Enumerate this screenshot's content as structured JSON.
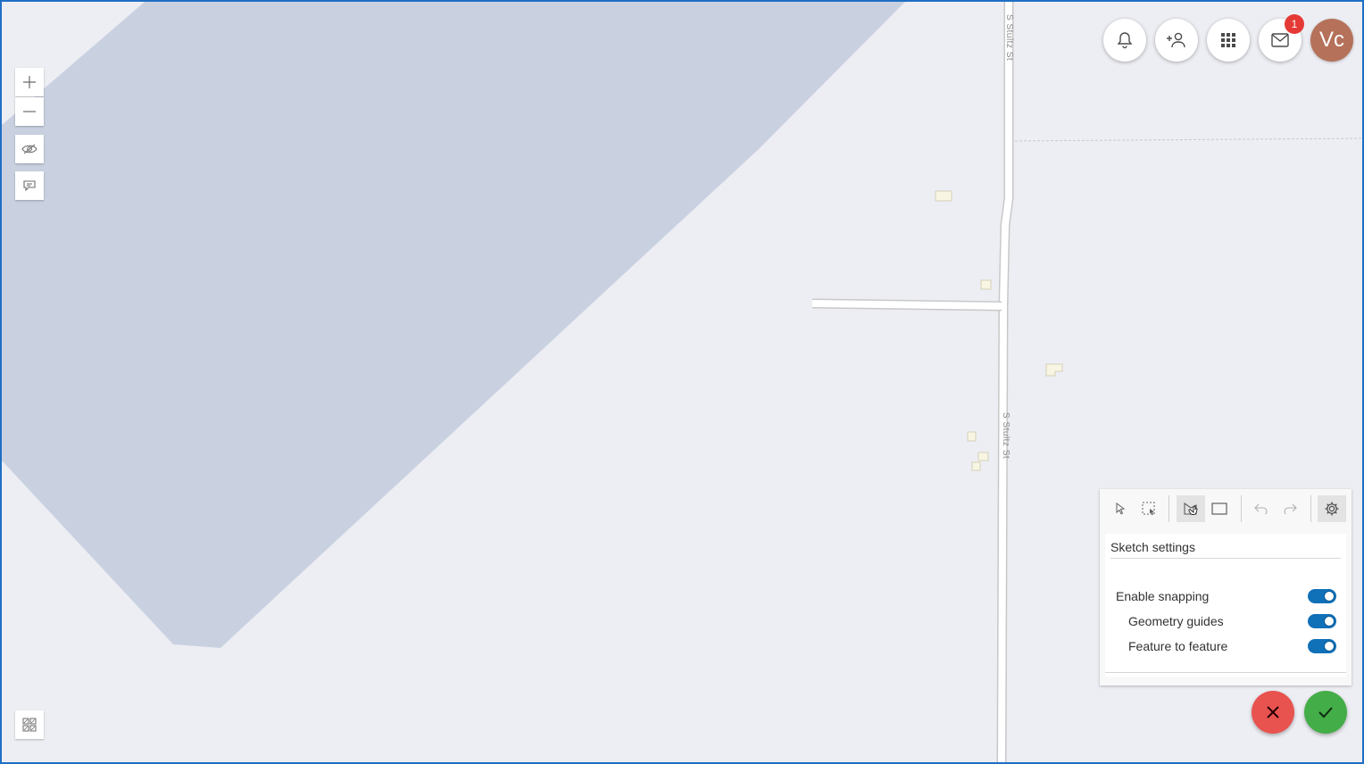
{
  "map": {
    "street_label": "S Stultz St",
    "colors": {
      "background": "#edeef3",
      "polygon": "#c9d1e1",
      "building": "#f8f6e3",
      "frame": "#1f6fc4"
    }
  },
  "map_controls": {
    "zoom_in_icon": "plus-icon",
    "zoom_out_icon": "minus-icon",
    "visibility_icon": "eye-icon",
    "comment_icon": "speech-bubble-icon",
    "basemap_icon": "grid-icon"
  },
  "header": {
    "notification_icon": "bell-icon",
    "add_user_icon": "add-person-icon",
    "apps_icon": "app-grid-icon",
    "mail_icon": "envelope-icon",
    "mail_badge": "1",
    "avatar_initials": "Vc",
    "avatar_color": "#b5715a"
  },
  "sketch_toolbar": {
    "tools": [
      "select-pointer-icon",
      "rectangle-select-icon",
      "polygon-draw-icon",
      "rectangle-draw-icon",
      "undo-icon",
      "redo-icon",
      "settings-gear-icon"
    ],
    "settings": {
      "title": "Sketch settings",
      "options": [
        {
          "label": "Enable snapping",
          "enabled": true
        },
        {
          "label": "Geometry guides",
          "enabled": true
        },
        {
          "label": "Feature to feature",
          "enabled": true
        }
      ]
    }
  },
  "actions": {
    "cancel_icon": "close-x-icon",
    "cancel_color": "#e8534f",
    "confirm_icon": "checkmark-icon",
    "confirm_color": "#43ad47"
  }
}
